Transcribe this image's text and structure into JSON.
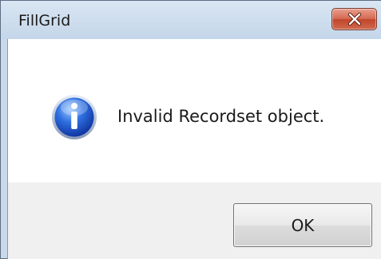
{
  "window": {
    "title": "FillGrid",
    "close_icon": "close-icon"
  },
  "dialog": {
    "icon": "info-icon",
    "message": "Invalid Recordset object.",
    "ok_label": "OK"
  }
}
